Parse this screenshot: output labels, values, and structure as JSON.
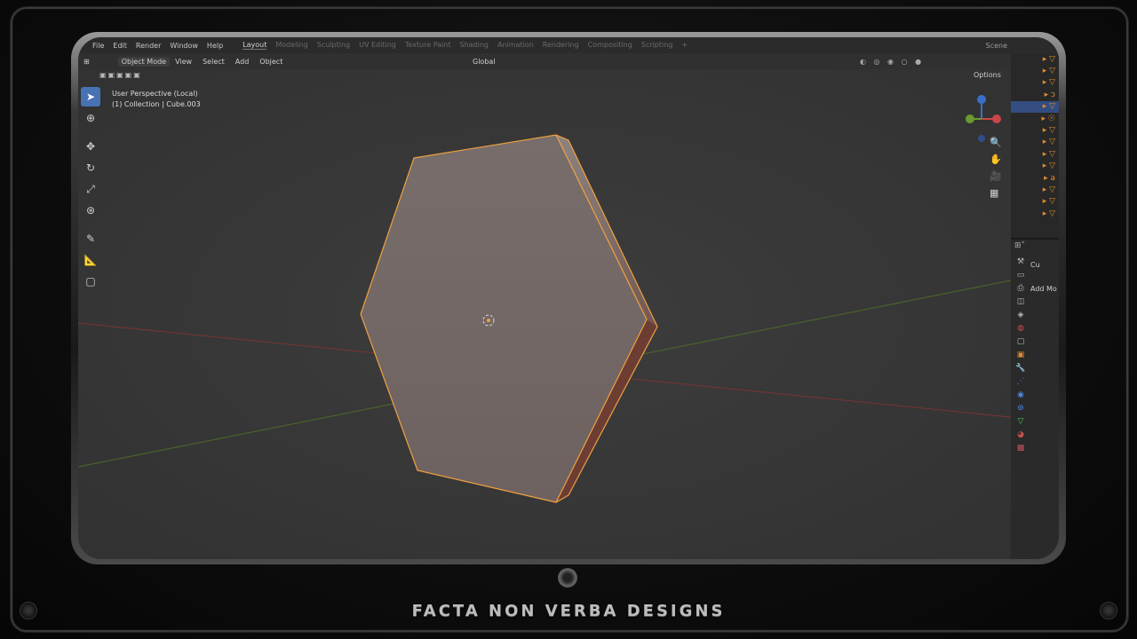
{
  "topbar": {
    "menus": [
      "File",
      "Edit",
      "Render",
      "Window",
      "Help"
    ],
    "workspaces": [
      "Layout",
      "Modeling",
      "Sculpting",
      "UV Editing",
      "Texture Paint",
      "Shading",
      "Animation",
      "Rendering",
      "Compositing",
      "Scripting",
      "+"
    ],
    "active_workspace": "Layout",
    "scene": "Scene"
  },
  "header": {
    "mode": "Object Mode",
    "menus": [
      "View",
      "Select",
      "Add",
      "Object"
    ],
    "orientation": "Global"
  },
  "viewport": {
    "perspective_label": "User Perspective (Local)",
    "collection_label": "(1) Collection | Cube.003",
    "options_label": "Options",
    "gizmo_axes": [
      "X",
      "Y",
      "Z"
    ]
  },
  "properties": {
    "object_name": "Cu",
    "add_modifier": "Add Mo"
  },
  "branding": {
    "text": "FACTA NON VERBA DESIGNS"
  },
  "colors": {
    "selection_outline": "#f0a040",
    "object_face": "#7a6e6c",
    "x_axis": "#a23a3a",
    "y_axis": "#5c7a2e",
    "active_tool": "#4772b3"
  }
}
